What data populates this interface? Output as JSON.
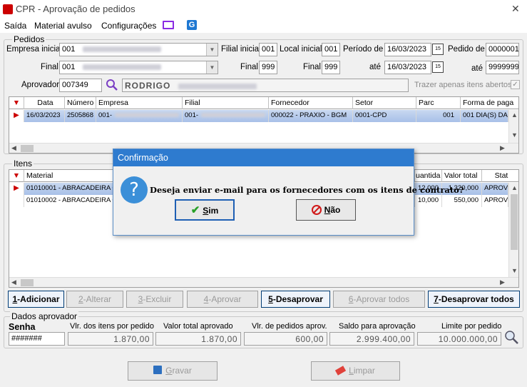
{
  "window": {
    "title": "CPR - Aprovação de pedidos",
    "close": "✕"
  },
  "menu": {
    "items": [
      "Saída",
      "Material avulso",
      "Configurações"
    ]
  },
  "pedidos": {
    "group_label": "Pedidos",
    "empresa_inicial_label": "Empresa inicial",
    "empresa_inicial_value": "001",
    "final_label": "Final",
    "empresa_final_value": "001",
    "filial_inicial_label": "Filial inicial",
    "filial_inicial_value": "001",
    "filial_final_label": "Final",
    "filial_final_value": "999",
    "local_inicial_label": "Local inicial",
    "local_inicial_value": "001",
    "local_final_label": "Final",
    "local_final_value": "999",
    "periodo_label": "Período de",
    "periodo_de": "16/03/2023",
    "ate_label": "até",
    "periodo_ate": "16/03/2023",
    "pedido_de_label": "Pedido de",
    "pedido_de_value": "0000001",
    "pedido_ate_label": "até",
    "pedido_ate_value": "9999999",
    "aprovador_label": "Aprovador",
    "aprovador_code": "007349",
    "aprovador_name": "RODRIGO",
    "trazer_label": "Trazer apenas itens abertos",
    "calendar_glyph": "15"
  },
  "pedidos_grid": {
    "headers": [
      "Data",
      "Número",
      "Empresa",
      "Filial",
      "Fornecedor",
      "Setor",
      "Parc",
      "Forma de paga"
    ],
    "rows": [
      {
        "data": "16/03/2023",
        "numero": "2505868",
        "empresa": "001-",
        "filial": "001-",
        "fornecedor": "000022 - PRAXIO - BGM",
        "setor": "0001-CPD",
        "parc": "001",
        "forma": "001 DIA(S) DA"
      }
    ]
  },
  "itens": {
    "group_label": "Itens",
    "headers": [
      "Material",
      "uantida",
      "Valor total",
      "Stat"
    ],
    "rows": [
      {
        "material": "01010001 - ABRACADEIRA C",
        "quantidade": "12,000",
        "valor_total": "1.320,000",
        "status": "APROV"
      },
      {
        "material": "01010002 - ABRACADEIRA C",
        "quantidade": "10,000",
        "valor_total": "550,000",
        "status": "APROV"
      }
    ]
  },
  "actions": {
    "adicionar": {
      "key": "1",
      "label": "-Adicionar"
    },
    "alterar": {
      "key": "2",
      "label": "-Alterar"
    },
    "excluir": {
      "key": "3",
      "label": "-Excluir"
    },
    "aprovar": {
      "key": "4",
      "label": "-Aprovar"
    },
    "desaprovar": {
      "key": "5",
      "label": "-Desaprovar"
    },
    "aprovar_todos": {
      "key": "6",
      "label": "-Aprovar todos"
    },
    "desaprovar_todos": {
      "key": "7",
      "label": "-Desaprovar todos"
    }
  },
  "dados": {
    "group_label": "Dados aprovador",
    "senha_label": "Senha",
    "senha_value": "#######",
    "vlr_itens_label": "Vlr. dos itens por pedido",
    "vlr_itens_value": "1.870,00",
    "valor_total_aprovado_label": "Valor total aprovado",
    "valor_total_aprovado_value": "1.870,00",
    "vlr_pedidos_aprov_label": "Vlr. de pedidos aprov.",
    "vlr_pedidos_aprov_value": "600,00",
    "saldo_label": "Saldo para aprovação",
    "saldo_value": "2.999.400,00",
    "limite_label": "Limite por pedido",
    "limite_value": "10.000.000,00"
  },
  "footer": {
    "gravar_key": "G",
    "gravar_rest": "ravar",
    "limpar_key": "L",
    "limpar_rest": "impar"
  },
  "dialog": {
    "title": "Confirmação",
    "message": "Deseja enviar e-mail para os fornecedores com os itens de contrato?",
    "icon": "?",
    "sim_key": "S",
    "sim_rest": "im",
    "nao_key": "N",
    "nao_rest": "ão"
  },
  "colors": {
    "accent": "#2e7bcf",
    "selection": "#b8cceb",
    "marker": "#cc0000"
  }
}
